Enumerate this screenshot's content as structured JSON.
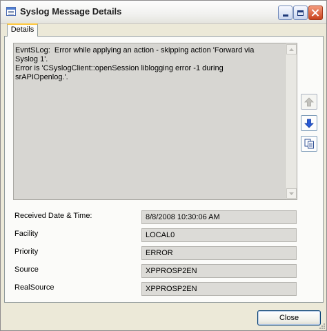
{
  "window": {
    "title": "Syslog Message Details",
    "icon": "window-icon"
  },
  "titlebar_buttons": {
    "minimize": "minimize-icon",
    "maximize": "maximize-icon",
    "close": "close-icon",
    "close_color": "#c9421c"
  },
  "tabs": [
    {
      "label": "Details",
      "active": true
    }
  ],
  "message": {
    "text": "EvntSLog:  Error while applying an action - skipping action 'Forward via Syslog 1'.\nError is 'CSyslogClient::openSession liblogging error -1 during srAPIOpenlog.'."
  },
  "side_buttons": [
    {
      "name": "previous-message",
      "icon": "arrow-up-icon",
      "enabled": false
    },
    {
      "name": "next-message",
      "icon": "arrow-down-icon",
      "enabled": true,
      "color": "#2a5bd7"
    },
    {
      "name": "copy-message",
      "icon": "copy-icon",
      "enabled": true
    }
  ],
  "fields": [
    {
      "label": "Received Date & Time:",
      "value": "8/8/2008 10:30:06 AM"
    },
    {
      "label": "Facility",
      "value": "LOCAL0"
    },
    {
      "label": "Priority",
      "value": "ERROR"
    },
    {
      "label": "Source",
      "value": "XPPROSP2EN"
    },
    {
      "label": "RealSource",
      "value": "XPPROSP2EN"
    }
  ],
  "footer": {
    "close_label": "Close"
  }
}
